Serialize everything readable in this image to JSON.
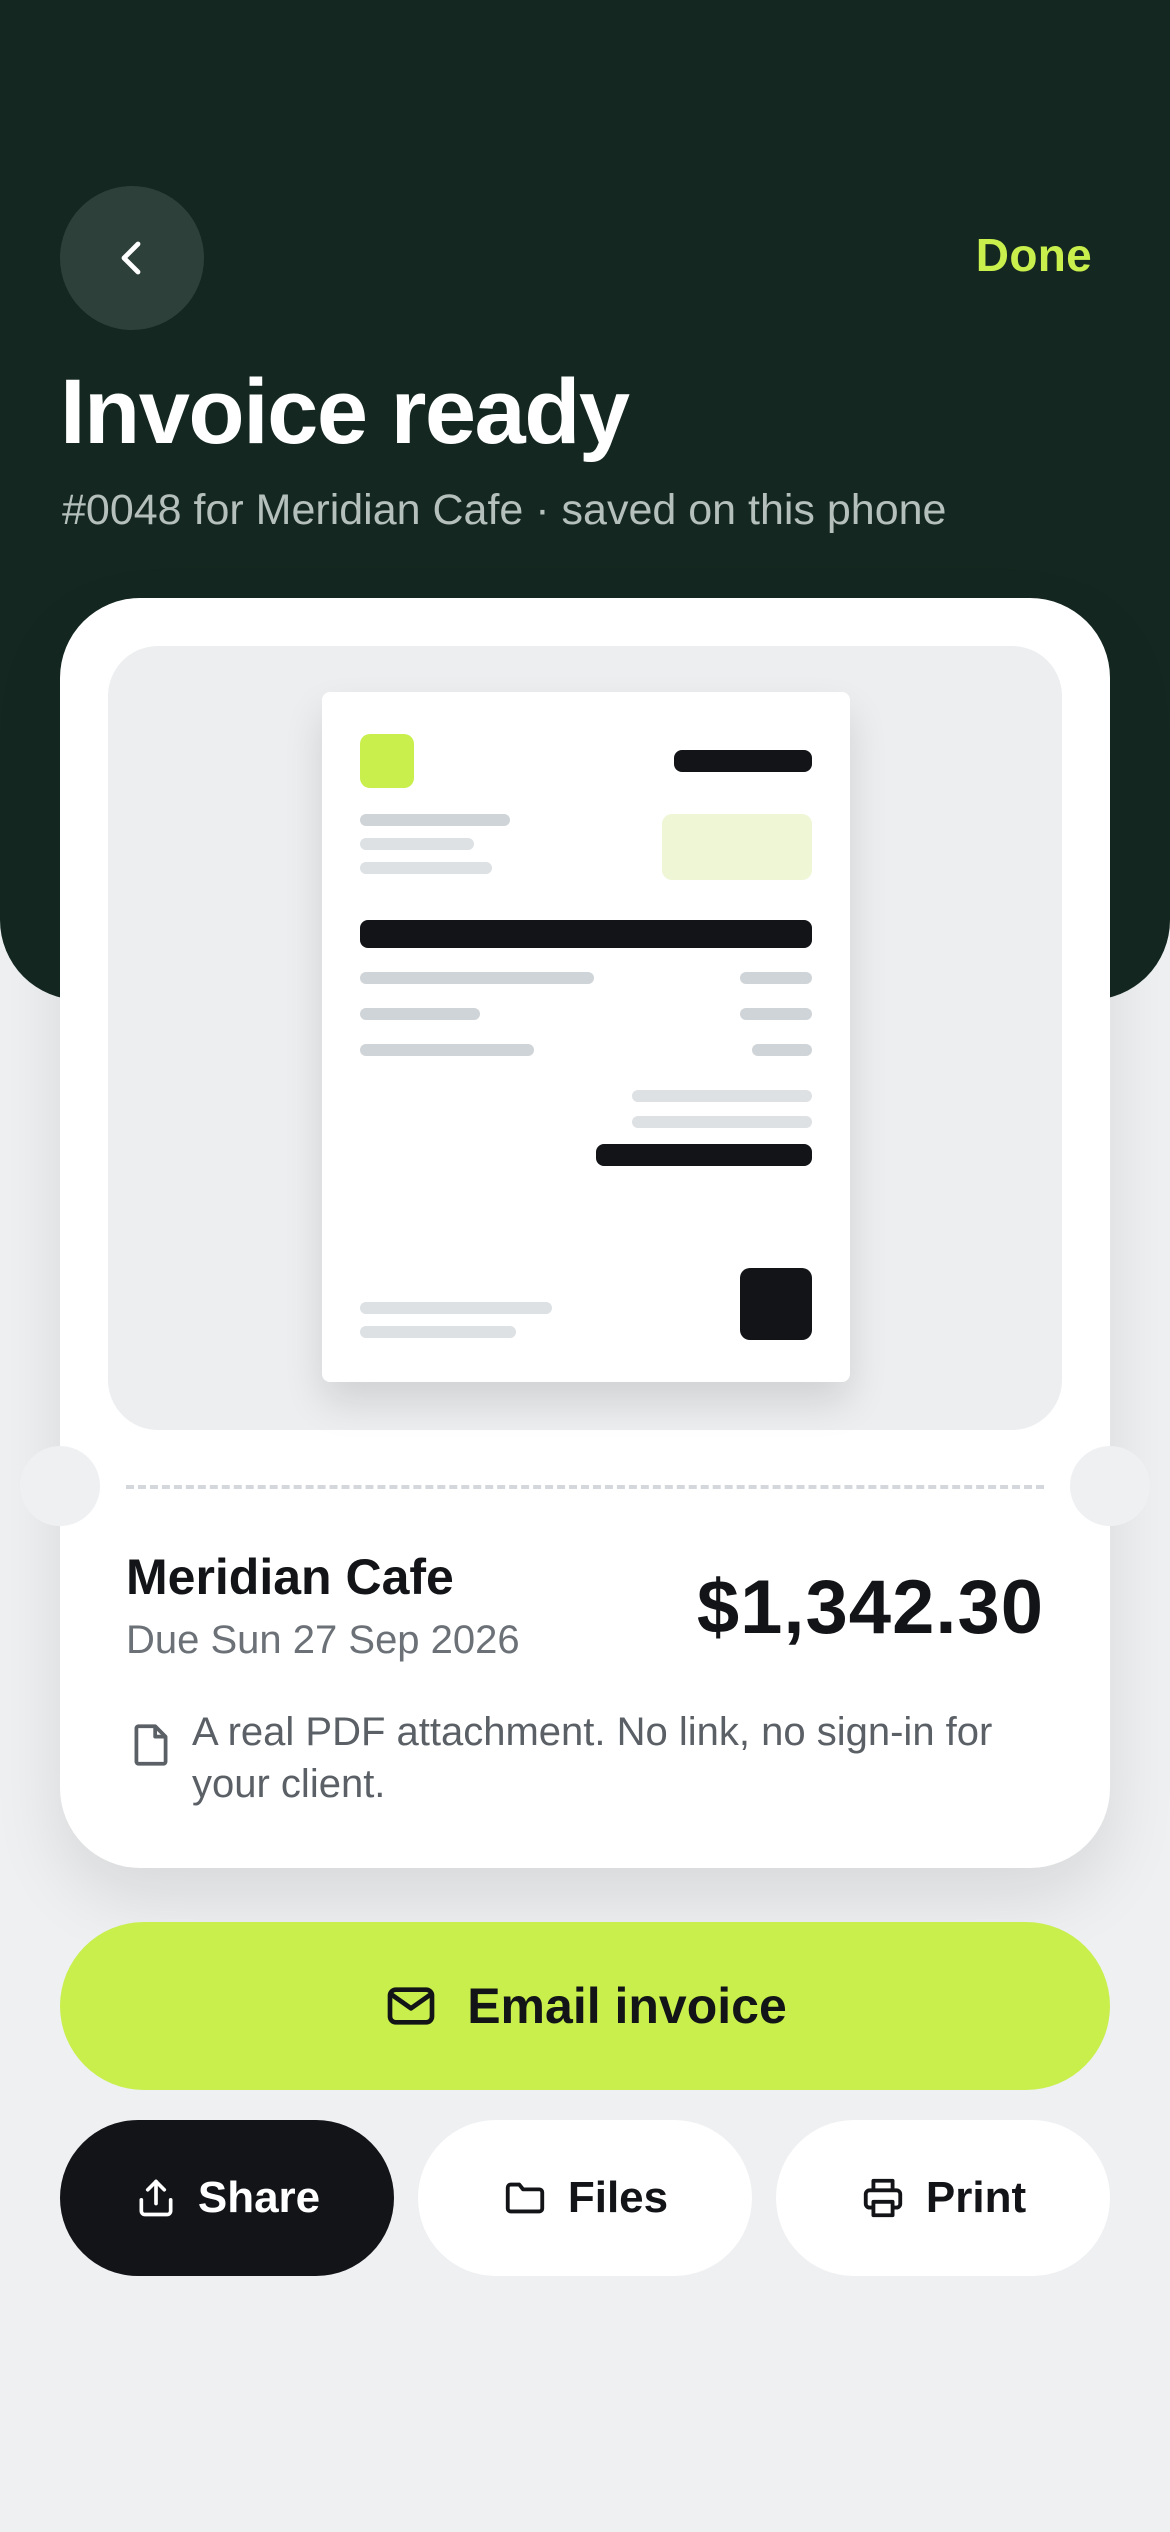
{
  "header": {
    "back_icon": "chevron-left-icon",
    "done_label": "Done",
    "title": "Invoice ready",
    "subtitle": "#0048 for Meridian Cafe · saved on this phone"
  },
  "invoice": {
    "client": "Meridian Cafe",
    "due": "Due Sun 27 Sep 2026",
    "amount": "$1,342.30",
    "note_icon": "file-icon",
    "note": "A real PDF attachment. No link, no sign-in for your client."
  },
  "actions": {
    "email_label": "Email invoice",
    "email_icon": "mail-icon",
    "share_label": "Share",
    "share_icon": "share-icon",
    "files_label": "Files",
    "files_icon": "folder-icon",
    "print_label": "Print",
    "print_icon": "printer-icon"
  },
  "colors": {
    "hero_bg": "#142821",
    "accent": "#c8ef4c",
    "dark": "#121417",
    "page_bg": "#eef0f2"
  }
}
